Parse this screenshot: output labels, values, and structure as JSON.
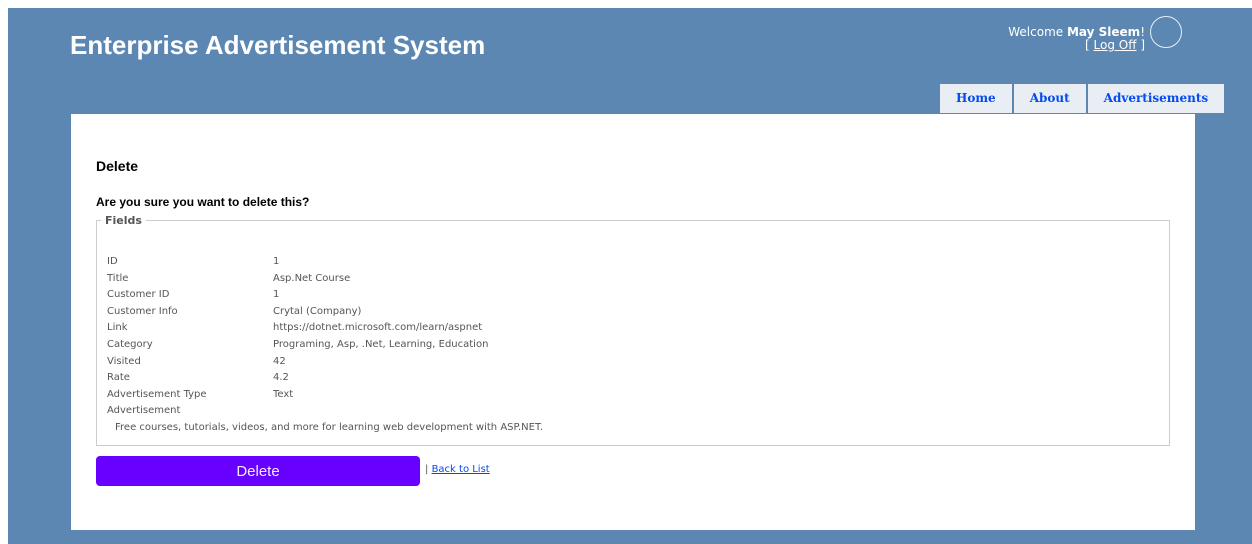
{
  "header": {
    "title": "Enterprise Advertisement System",
    "welcome_text": "Welcome",
    "username": "May Sleem",
    "exclaim": "!",
    "logoff_open": "[ ",
    "logoff_label": "Log Off",
    "logoff_close": " ]",
    "avatar_icon": "user-avatar-circle"
  },
  "menu": {
    "items": [
      {
        "label": "Home"
      },
      {
        "label": "About"
      },
      {
        "label": "Advertisements"
      }
    ]
  },
  "main": {
    "heading": "Delete",
    "question": "Are you sure you want to delete this?",
    "legend": "Fields",
    "fields": [
      {
        "label": "ID",
        "value": "1"
      },
      {
        "label": "Title",
        "value": "Asp.Net Course"
      },
      {
        "label": "Customer ID",
        "value": "1"
      },
      {
        "label": "Customer Info",
        "value": "Crytal (Company)"
      },
      {
        "label": "Link",
        "value": "https://dotnet.microsoft.com/learn/aspnet"
      },
      {
        "label": "Category",
        "value": "Programing, Asp, .Net, Learning, Education"
      },
      {
        "label": "Visited",
        "value": "42"
      },
      {
        "label": "Rate",
        "value": "4.2"
      },
      {
        "label": "Advertisement Type",
        "value": "Text"
      }
    ],
    "advertisement_label": "Advertisement",
    "advertisement_text": "Free courses, tutorials, videos, and more for learning web development with ASP.NET.",
    "delete_label": "Delete",
    "separator": "| ",
    "back_label": "Back to List"
  },
  "colors": {
    "page_background": "#5c87b2",
    "delete_button": "#6700ff",
    "menu_text": "#034af3"
  }
}
